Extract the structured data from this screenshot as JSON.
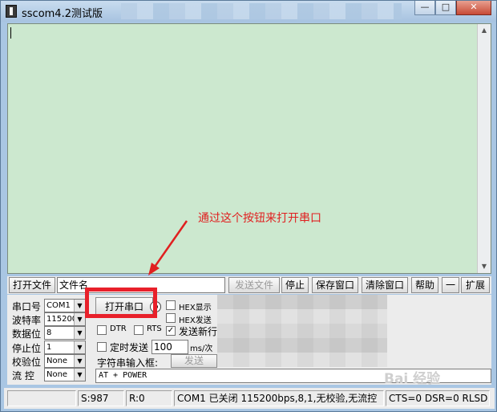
{
  "window": {
    "title": "sscom4.2测试版",
    "caption_min": "—",
    "caption_max": "□",
    "caption_close": "✕"
  },
  "annotation": {
    "text": "通过这个按钮来打开串口",
    "color": "#e02020"
  },
  "file_row": {
    "open_file_label": "打开文件",
    "file_name_value": "文件名",
    "send_file_label": "发送文件",
    "stop_label": "停止",
    "save_window_label": "保存窗口",
    "clear_window_label": "清除窗口",
    "help_label": "帮助",
    "dash_label": "一",
    "expand_label": "扩展"
  },
  "settings": {
    "port_label": "串口号",
    "port_value": "COM1",
    "baud_label": "波特率",
    "baud_value": "115200",
    "databits_label": "数据位",
    "databits_value": "8",
    "stopbits_label": "停止位",
    "stopbits_value": "1",
    "parity_label": "校验位",
    "parity_value": "None",
    "flow_label": "流  控",
    "flow_value": "None"
  },
  "controls": {
    "open_port_label": "打开串口",
    "hex_display_label": "HEX显示",
    "hex_send_label": "HEX发送",
    "dtr_label": "DTR",
    "rts_label": "RTS",
    "send_newline_label": "发送新行",
    "timed_send_label": "定时发送",
    "interval_value": "100",
    "interval_unit": "ms/次",
    "string_input_label": "字符串输入框:",
    "send_label": "发送",
    "input_value": "AT + POWER",
    "send_newline_checked": true,
    "highlight_color": "#e8202a"
  },
  "status": {
    "s_count": "S:987",
    "r_count": "R:0",
    "port_state": "COM1 已关闭  115200bps,8,1,无校验,无流控",
    "signals": "CTS=0 DSR=0 RLSD"
  },
  "watermark": "Bai 经验"
}
